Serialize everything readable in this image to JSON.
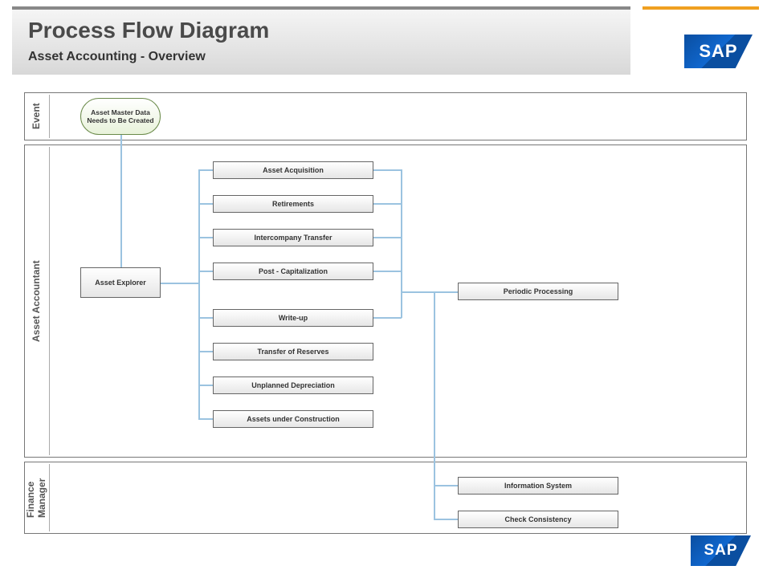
{
  "header": {
    "title": "Process Flow Diagram",
    "subtitle": "Asset Accounting - Overview"
  },
  "logo": {
    "text": "SAP"
  },
  "lanes": {
    "event": "Event",
    "asset_accountant": "Asset Accountant",
    "finance_manager": "Finance\nManager"
  },
  "start_event": "Asset Master Data Needs to Be Created",
  "asset_explorer": "Asset Explorer",
  "processes": [
    "Asset Acquisition",
    "Retirements",
    "Intercompany Transfer",
    "Post - Capitalization",
    "Write-up",
    "Transfer of Reserves",
    "Unplanned Depreciation",
    "Assets under Construction"
  ],
  "periodic": "Periodic Processing",
  "info_system": "Information System",
  "check_consistency": "Check Consistency"
}
